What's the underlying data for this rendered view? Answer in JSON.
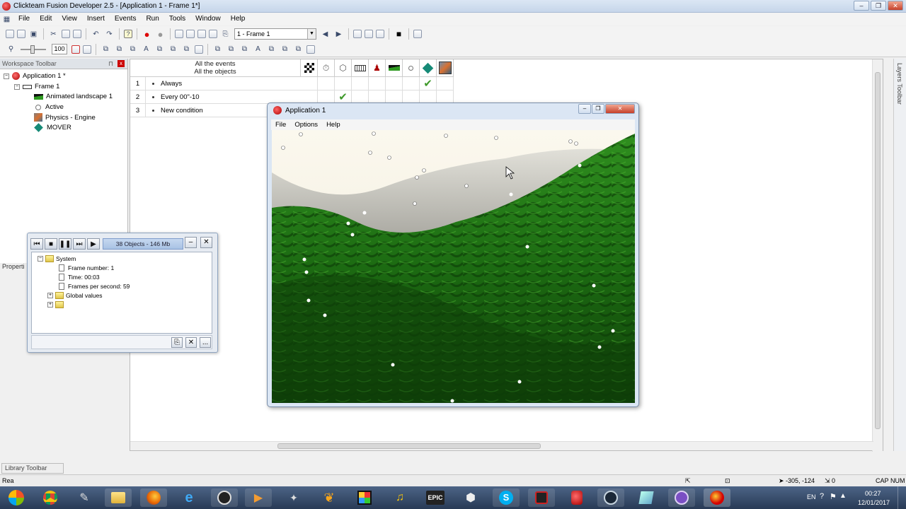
{
  "window": {
    "title": "Clickteam Fusion Developer 2.5 - [Application 1 - Frame 1*]",
    "controls": {
      "minimize": "–",
      "restore": "❐",
      "close": "✕"
    }
  },
  "menu": [
    "File",
    "Edit",
    "View",
    "Insert",
    "Events",
    "Run",
    "Tools",
    "Window",
    "Help"
  ],
  "toolbar": {
    "frame_select": "1 - Frame 1",
    "zoom_value": "100"
  },
  "workspace": {
    "title": "Workspace Toolbar",
    "pin": "⊓",
    "close": "x",
    "tree": {
      "app": "Application 1 *",
      "frame": "Frame 1",
      "objects": [
        "Animated landscape 1",
        "Active",
        "Physics - Engine",
        "MOVER"
      ]
    },
    "properties_label": "Properti"
  },
  "events": {
    "header_line1": "All the events",
    "header_line2": "All the objects",
    "rows": [
      {
        "num": "1",
        "text": "Always"
      },
      {
        "num": "2",
        "text": "Every 00\"-10"
      },
      {
        "num": "3",
        "text": "New condition"
      }
    ],
    "checkmark": "✔"
  },
  "layers_toolbar": "Layers Toolbar",
  "library_toolbar": "Library Toolbar",
  "status": {
    "left": "Rea",
    "coords": "-305, -124",
    "count": "0",
    "caps": "CAP",
    "num": "NUM"
  },
  "debugger": {
    "objects_info": "38 Objects - 146 Mb",
    "minimize": "–",
    "close": "✕",
    "system": "System",
    "frame_number": "Frame number: 1",
    "time": "Time: 00:03",
    "fps": "Frames per second: 59",
    "global_values": "Global values",
    "footer_more": "..."
  },
  "app_window": {
    "title": "Application 1",
    "menu": [
      "File",
      "Options",
      "Help"
    ]
  },
  "taskbar": {
    "lang": "EN",
    "time": "00:27",
    "date": "12/01/2017",
    "epic_label": "EPIC"
  },
  "colors": {
    "accent_blue": "#c6d6ea",
    "grass_dark": "#1f5a12",
    "grass_light": "#3aa02a",
    "sky": "#f8f4e6"
  }
}
